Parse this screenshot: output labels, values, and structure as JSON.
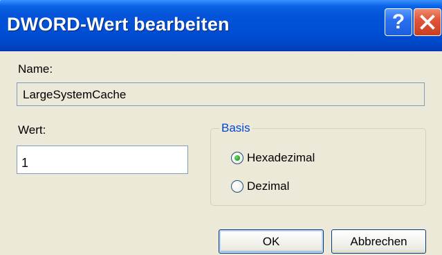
{
  "window": {
    "title": "DWORD-Wert bearbeiten",
    "help_glyph": "?",
    "close_icon": "close-icon"
  },
  "colors": {
    "titlebar": "#0050d6",
    "dialog_bg": "#ece9d8",
    "groupbox_title": "#0046d5",
    "close_button": "#e0553a",
    "radio_selected": "#21a121"
  },
  "name_section": {
    "label": "Name:",
    "value": "LargeSystemCache"
  },
  "value_section": {
    "label": "Wert:",
    "value": "1"
  },
  "basis": {
    "title": "Basis",
    "options": [
      {
        "label": "Hexadezimal",
        "selected": true
      },
      {
        "label": "Dezimal",
        "selected": false
      }
    ]
  },
  "buttons": {
    "ok": "OK",
    "cancel": "Abbrechen"
  }
}
